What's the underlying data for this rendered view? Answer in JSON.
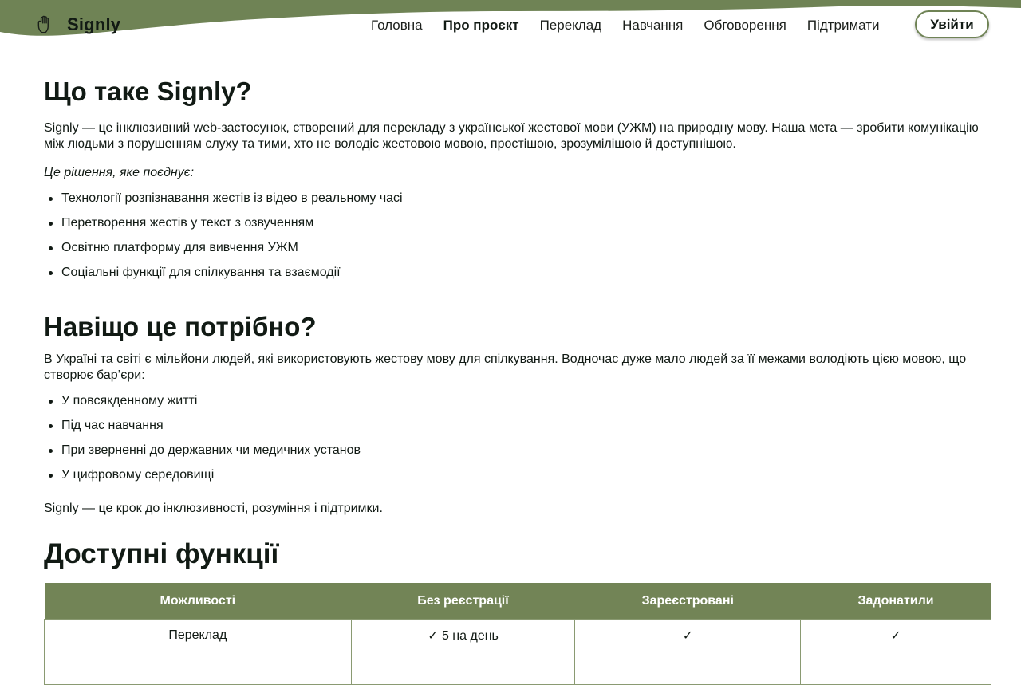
{
  "header": {
    "brand": "Signly",
    "icon": "hand-icon",
    "nav": [
      "Головна",
      "Про проєкт",
      "Переклад",
      "Навчання",
      "Обговорення",
      "Підтримати"
    ],
    "active_nav": "Про проєкт",
    "login_label": "Увійти",
    "accent_color": "#728456"
  },
  "about": {
    "title": "Що таке Signly?",
    "intro": "Signly — це інклюзивний web-застосунок, створений для перекладу з української жестової мови (УЖМ) на природну мову. Наша мета — зробити комунікацію між людьми з порушенням слуху та тими, хто не володіє жестовою мовою, простішою, зрозумілішою й доступнішою.",
    "combines": "Це рішення, яке поєднує:",
    "items": [
      "Технології розпізнавання жестів із відео в реальному часі",
      "Перетворення жестів у текст з озвученням",
      "Освітню платформу для вивчення УЖМ",
      "Соціальні функції для спілкування та взаємодії"
    ]
  },
  "why": {
    "title": "Навіщо це потрібно?",
    "text": "В Україні та світі є мільйони людей, які використовують жестову мову для спілкування. Водночас дуже мало людей за її межами володіють цією мовою, що створює бар’єри:",
    "items": [
      "У повсякденному житті",
      "Під час навчання",
      "При зверненні до державних чи медичних установ",
      "У цифровому середовищі"
    ],
    "closing": "Signly — це крок до інклюзивності, розуміння і підтримки."
  },
  "features": {
    "title": "Доступні функції",
    "columns": [
      "Можливості",
      "Без реєстрації",
      "Зареєстровані",
      "Задонатили"
    ],
    "rows": [
      [
        "Переклад",
        "✓ 5 на день",
        "✓",
        "✓"
      ]
    ]
  }
}
